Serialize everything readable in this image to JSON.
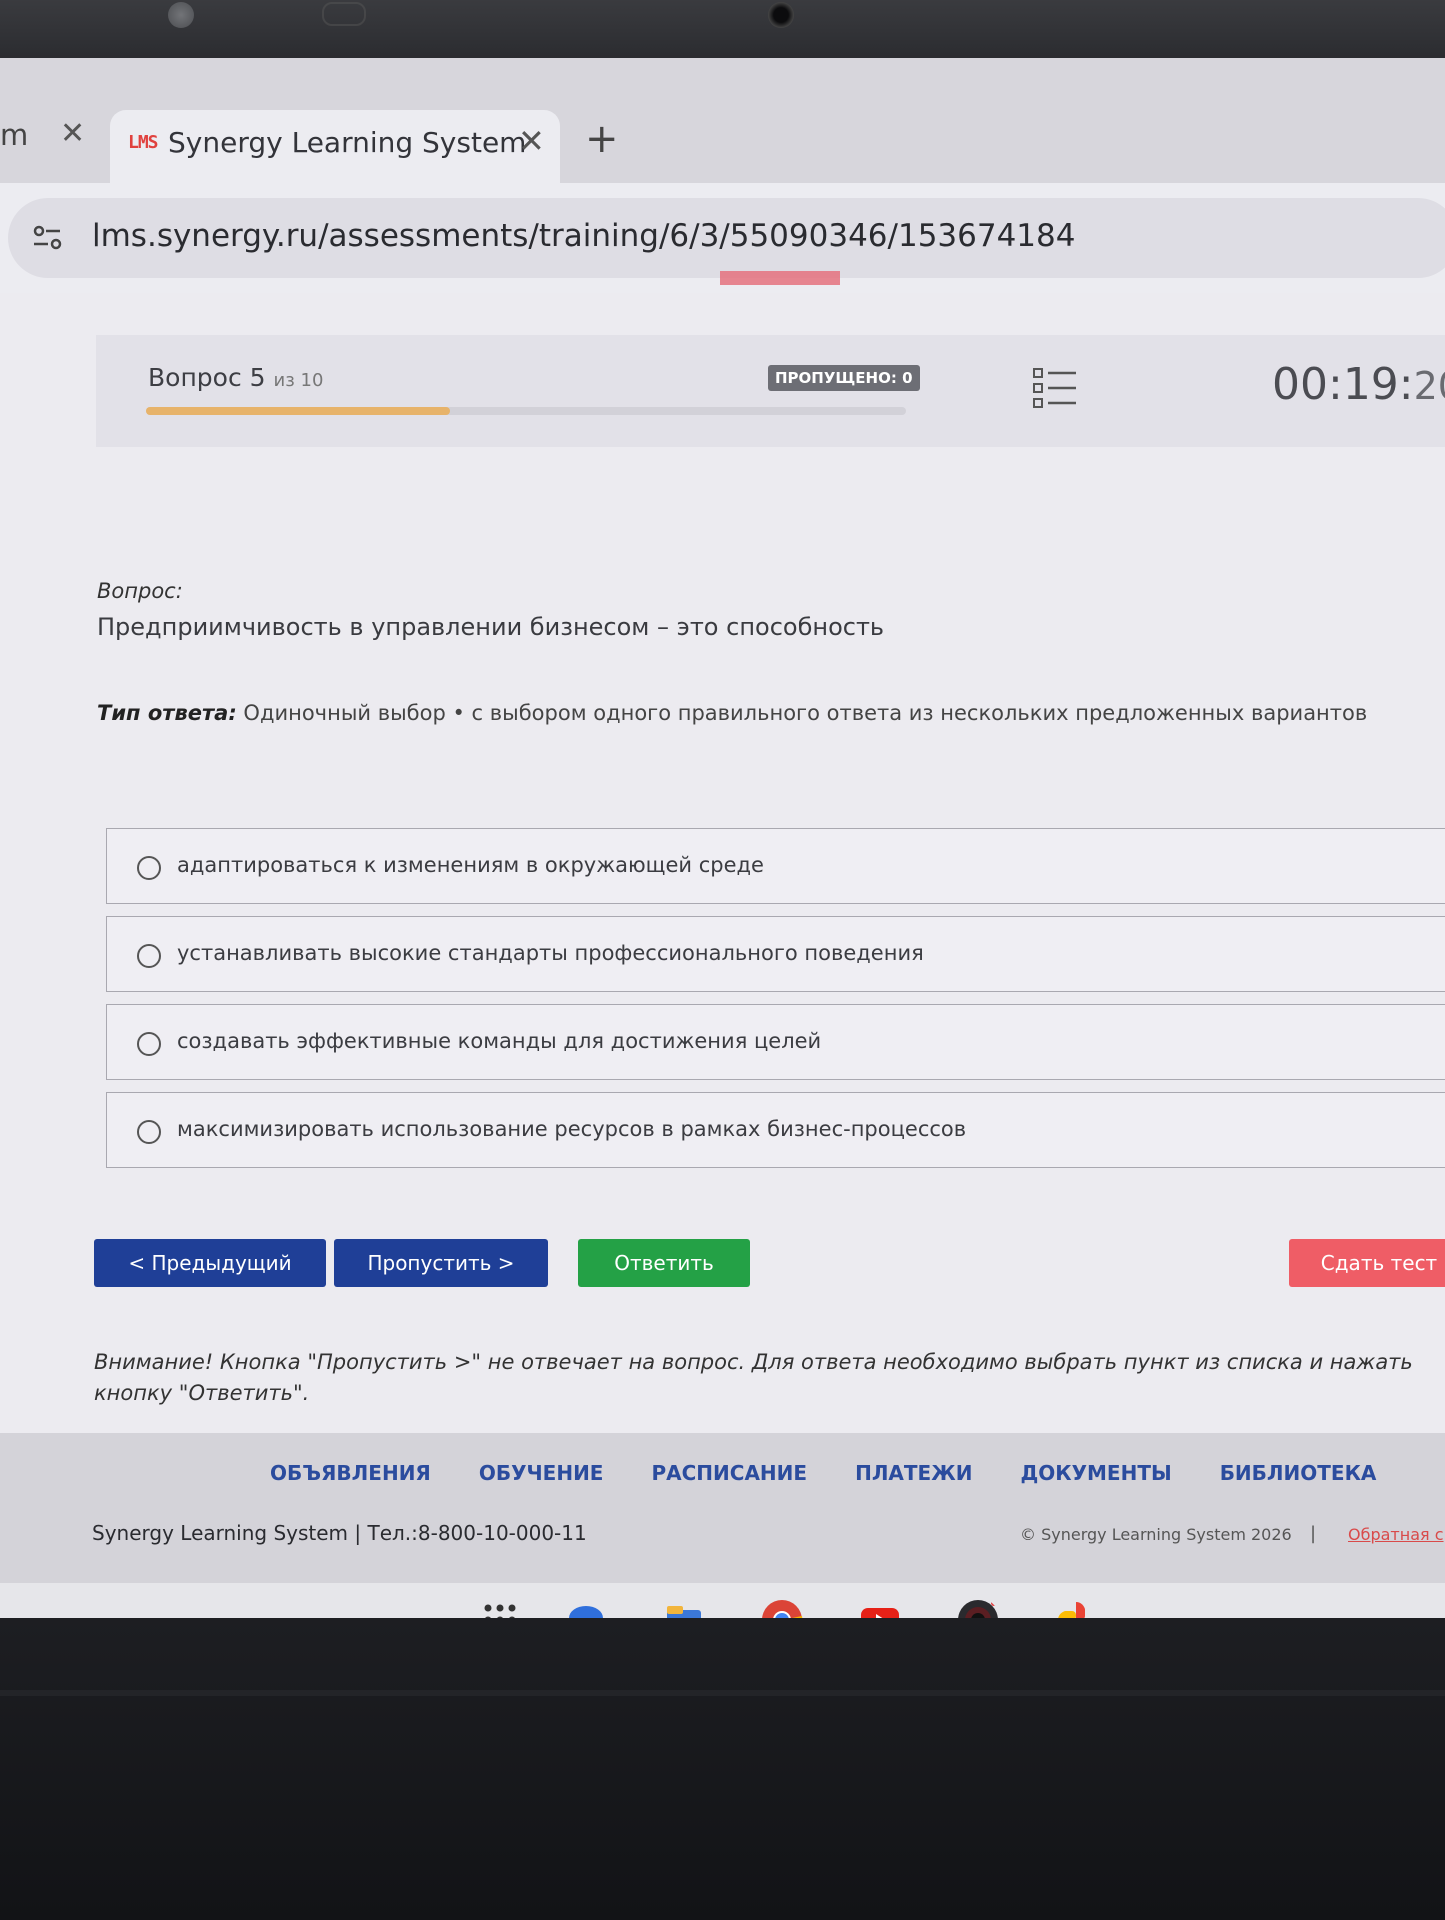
{
  "browser": {
    "prev_tab_fragment": "m",
    "active_tab": {
      "logo": "LMS",
      "title": "Synergy Learning System"
    },
    "url": "lms.synergy.ru/assessments/training/6/3/55090346/153674184"
  },
  "quiz": {
    "question_label": "Вопрос 5",
    "question_total": "из 10",
    "progress": 0.4,
    "skipped_badge": "ПРОПУЩЕНО: 0",
    "timer_main": "00:19:",
    "timer_seconds": "20",
    "question_heading": "Вопрос:",
    "question_text": "Предприимчивость в управлении бизнесом – это способность",
    "answer_type_label": "Тип ответа:",
    "answer_type_text": " Одиночный выбор • с выбором одного правильного ответа из нескольких предложенных вариантов",
    "options": [
      "адаптироваться к изменениям в окружающей среде",
      "устанавливать высокие стандарты профессионального поведения",
      "создавать эффективные команды для достижения целей",
      "максимизировать использование ресурсов в рамках бизнес-процессов"
    ],
    "buttons": {
      "prev": "< Предыдущий",
      "skip": "Пропустить >",
      "answer": "Ответить",
      "submit": "Сдать тест"
    },
    "notice": "Внимание! Кнопка \"Пропустить >\" не отвечает на вопрос. Для ответа необходимо выбрать пункт из списка и нажать кнопку \"Ответить\"."
  },
  "footer": {
    "nav": [
      "ОБЪЯВЛЕНИЯ",
      "ОБУЧЕНИЕ",
      "РАСПИСАНИЕ",
      "ПЛАТЕЖИ",
      "ДОКУМЕНТЫ",
      "БИБЛИОТЕКА"
    ],
    "brand": "Synergy Learning System  |  Тел.:8-800-10-000-11",
    "copyright": "© Synergy Learning System 2026",
    "separator": "|",
    "feedback": "Обратная с"
  },
  "taskbar": {
    "icons": [
      "launcher-icon",
      "messages-icon",
      "files-icon",
      "chrome-icon",
      "youtube-icon",
      "camera-icon",
      "photos-icon"
    ]
  },
  "colors": {
    "primary_button": "#1f3f97",
    "answer_button": "#24a146",
    "submit_button": "#ef5d66",
    "progress": "#e7b36a",
    "footer_link": "#2b4c9e"
  }
}
